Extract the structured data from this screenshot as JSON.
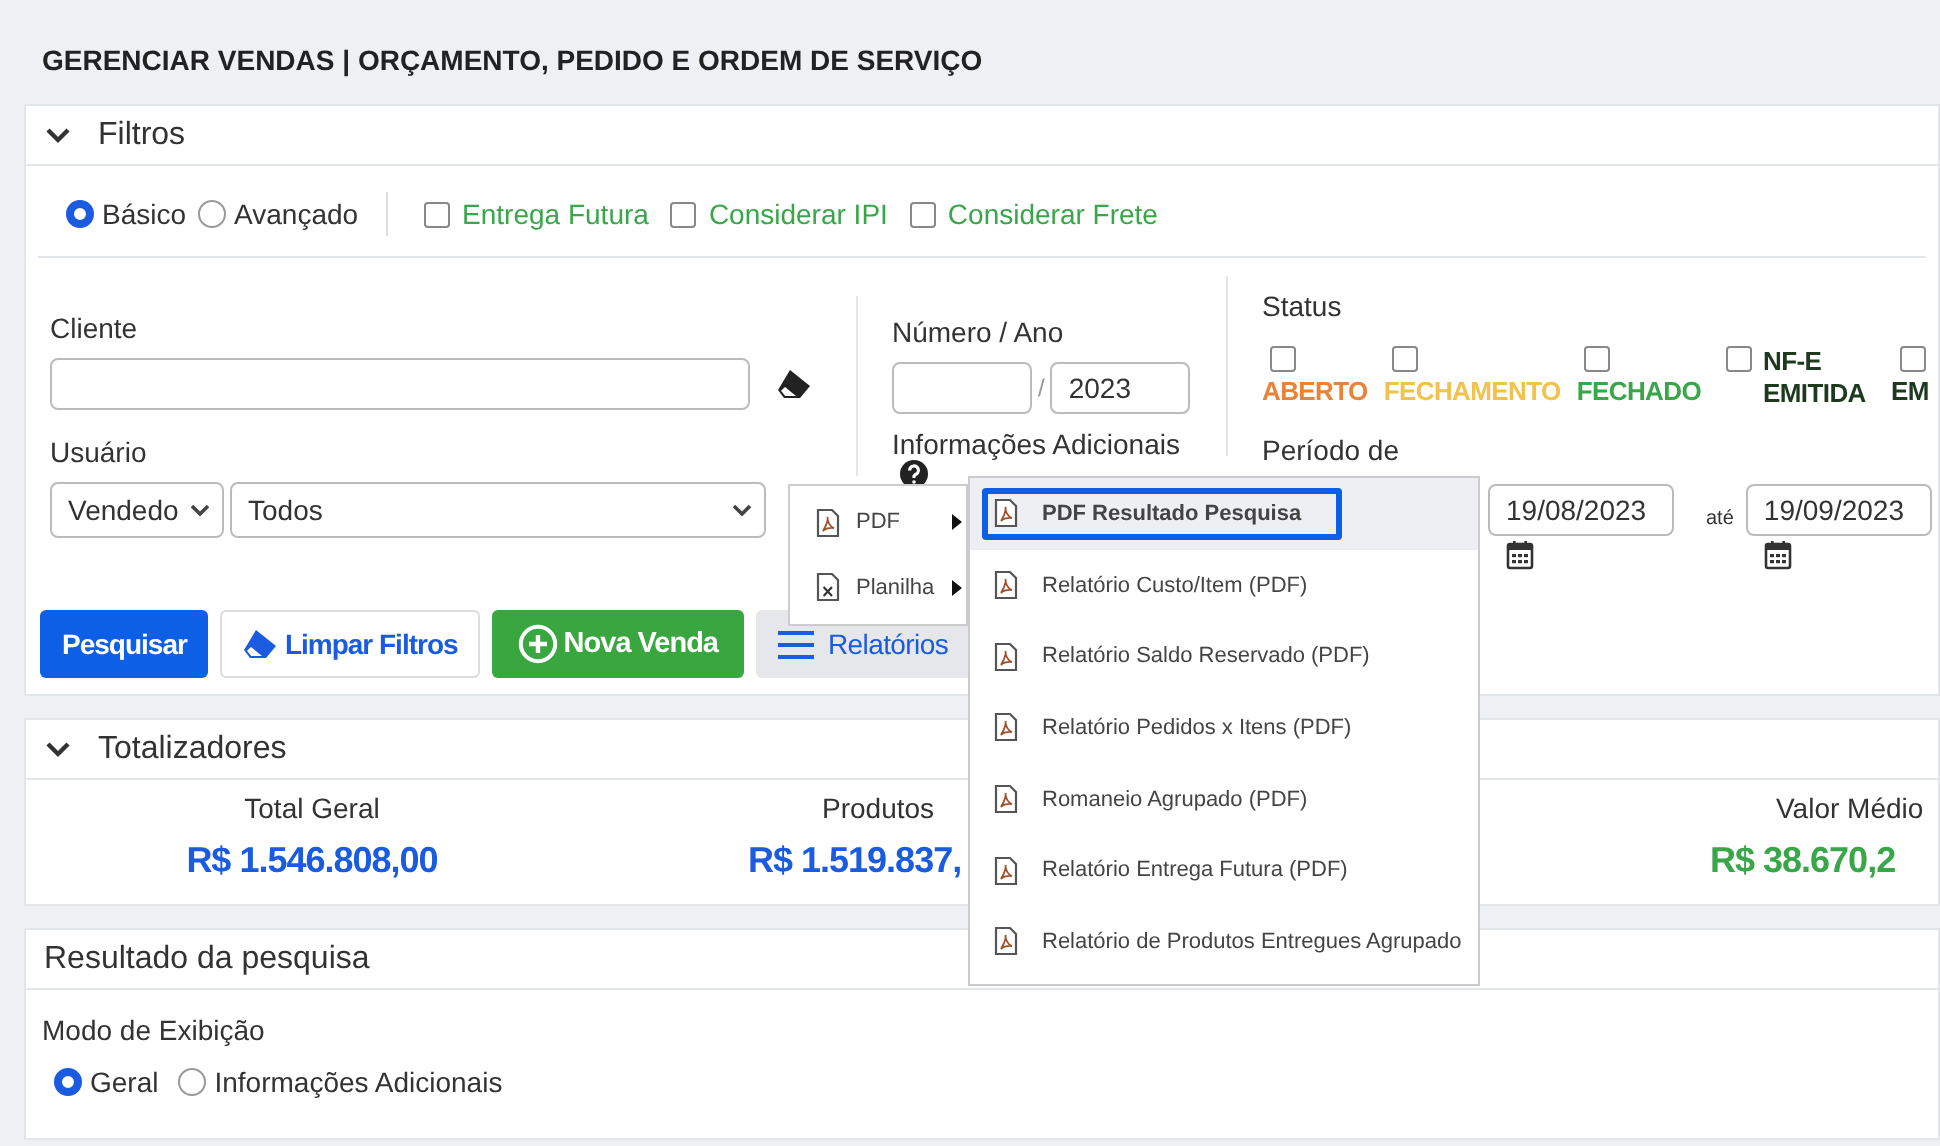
{
  "page_title": "GERENCIAR VENDAS | ORÇAMENTO, PEDIDO E ORDEM DE SERVIÇO",
  "filters": {
    "title": "Filtros",
    "expanded": true,
    "modes": [
      {
        "label": "Básico",
        "selected": true
      },
      {
        "label": "Avançado",
        "selected": false
      }
    ],
    "options": [
      {
        "label": "Entrega Futura",
        "checked": false
      },
      {
        "label": "Considerar IPI",
        "checked": false
      },
      {
        "label": "Considerar Frete",
        "checked": false
      }
    ],
    "cliente": {
      "label": "Cliente"
    },
    "usuario": {
      "label": "Usuário",
      "type_select": "Vendedo",
      "user_select": "Todos"
    },
    "numero_ano": {
      "label": "Número / Ano",
      "separator": "/",
      "year": "2023"
    },
    "info_adicionais": {
      "label": "Informações Adicionais"
    },
    "status": {
      "label": "Status",
      "items": [
        {
          "label": "ABERTO",
          "kind": "stacked",
          "checked": false,
          "color": "#e8833a"
        },
        {
          "label": "FECHAMENTO",
          "kind": "stacked",
          "checked": false,
          "color": "#f2c14e"
        },
        {
          "label": "FECHADO",
          "kind": "stacked",
          "checked": false,
          "color": "#3aa64a"
        },
        {
          "label": "NF-E EMITIDA",
          "kind": "inline",
          "checked": false,
          "color": "#1d3a1f"
        },
        {
          "label": "EM",
          "kind": "stacked",
          "checked": false,
          "color": "#1d3a1f"
        }
      ]
    },
    "periodo": {
      "label": "Período de",
      "from": "19/08/2023",
      "to_label": "até",
      "to": "19/09/2023"
    },
    "buttons": [
      {
        "label": "Pesquisar",
        "kind": "primary"
      },
      {
        "label": "Limpar Filtros",
        "kind": "outline"
      },
      {
        "label": "Nova Venda",
        "kind": "success"
      },
      {
        "label": "Relatórios",
        "kind": "menu",
        "expanded": true
      }
    ]
  },
  "reports_menu": {
    "items": [
      {
        "label": "PDF",
        "kind": "pdf"
      },
      {
        "label": "Planilha",
        "kind": "sheet"
      }
    ],
    "submenu": [
      {
        "label": "PDF Resultado Pesquisa",
        "selected": true
      },
      {
        "label": "Relatório Custo/Item (PDF)",
        "selected": false
      },
      {
        "label": "Relatório Saldo Reservado (PDF)",
        "selected": false
      },
      {
        "label": "Relatório Pedidos x Itens (PDF)",
        "selected": false
      },
      {
        "label": "Romaneio Agrupado (PDF)",
        "selected": false
      },
      {
        "label": "Relatório Entrega Futura (PDF)",
        "selected": false
      },
      {
        "label": "Relatório de Produtos Entregues Agrupado",
        "selected": false
      }
    ]
  },
  "totals": {
    "title": "Totalizadores",
    "expanded": true,
    "items": [
      {
        "label": "Total Geral",
        "value": "R$ 1.546.808,00",
        "color": "#1a5be0"
      },
      {
        "label": "Produtos",
        "value": "R$ 1.519.837,",
        "color": "#1a5be0"
      },
      {
        "label": "Valor Médio",
        "value": "R$ 38.670,2",
        "color": "#3aa64a"
      }
    ]
  },
  "results": {
    "title": "Resultado da pesquisa",
    "view_label": "Modo de Exibição",
    "views": [
      {
        "label": "Geral",
        "selected": true
      },
      {
        "label": "Informações Adicionais",
        "selected": false
      }
    ]
  }
}
